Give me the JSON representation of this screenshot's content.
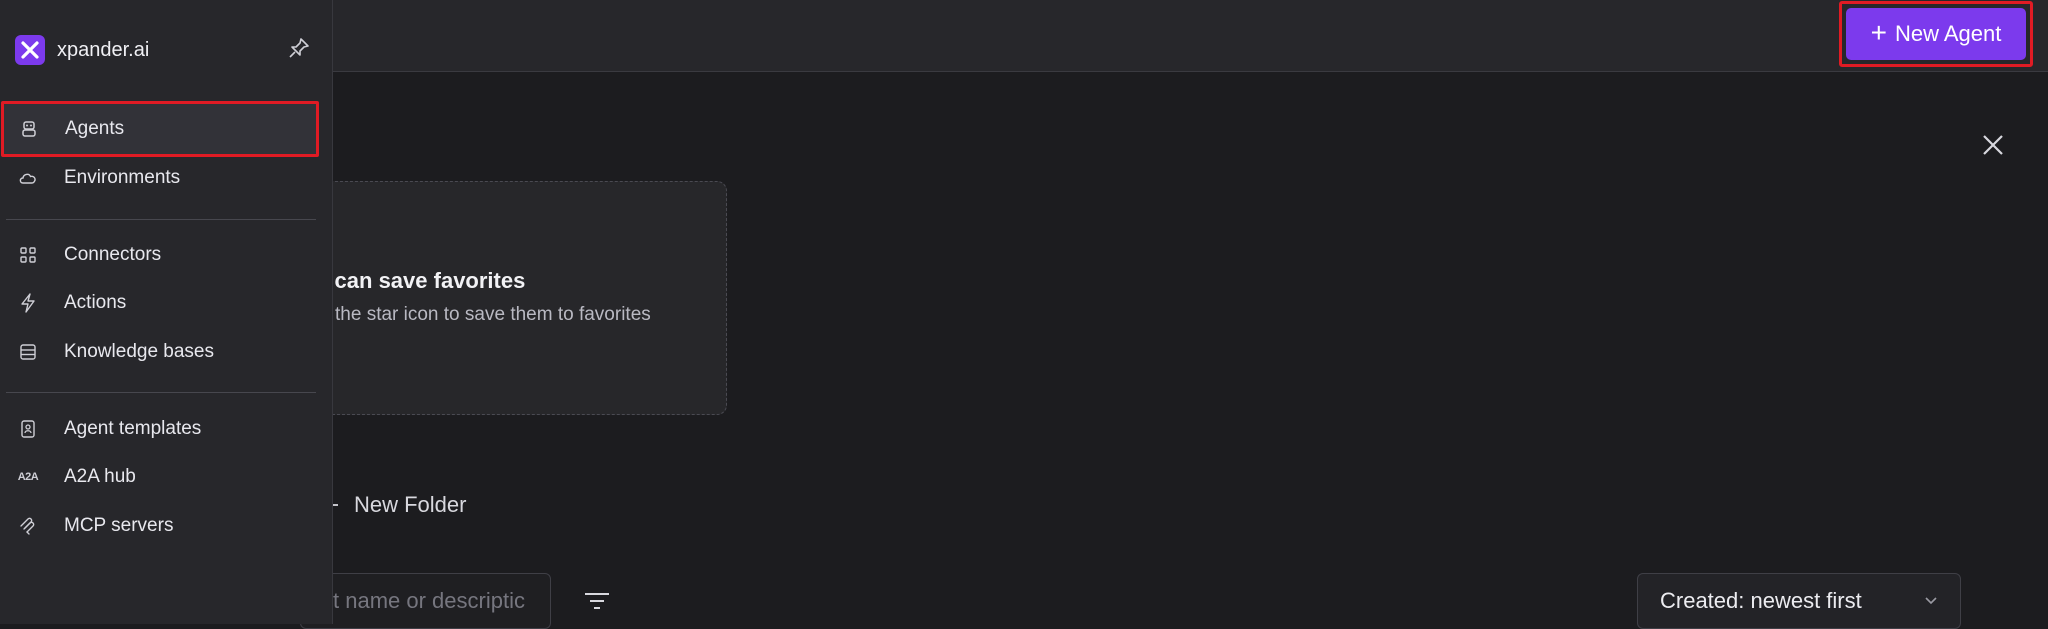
{
  "app": {
    "name": "xpander.ai"
  },
  "header": {
    "new_agent_label": "New Agent"
  },
  "sidebar": {
    "items": [
      {
        "label": "Agents",
        "icon": "robot-icon",
        "active": true
      },
      {
        "label": "Environments",
        "icon": "cloud-icon"
      },
      {
        "label": "Connectors",
        "icon": "grid-icon"
      },
      {
        "label": "Actions",
        "icon": "bolt-icon"
      },
      {
        "label": "Knowledge bases",
        "icon": "database-icon"
      },
      {
        "label": "Agent templates",
        "icon": "template-icon"
      },
      {
        "label": "A2A hub",
        "icon": "a2a-icon",
        "icon_text": "A2A"
      },
      {
        "label": "MCP servers",
        "icon": "mcp-icon"
      }
    ]
  },
  "favorites": {
    "title": "u can save favorites",
    "subtitle": "the star icon to save them to favorites"
  },
  "toolbar": {
    "new_folder_label": "New Folder",
    "search_placeholder": "t name or descriptic",
    "sort_value": "Created: newest first"
  },
  "colors": {
    "accent": "#7c3aed",
    "highlight": "#e01b24"
  }
}
